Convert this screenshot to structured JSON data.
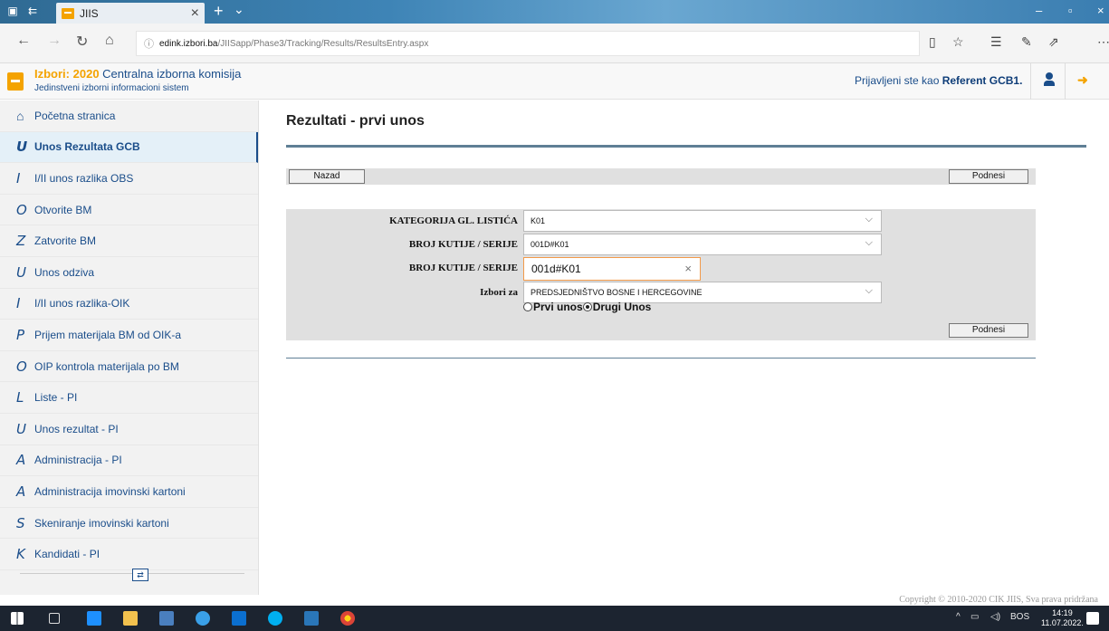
{
  "browser": {
    "tab_title": "JIIS",
    "url_host": "edink.izbori.ba",
    "url_path": "/JIISapp/Phase3/Tracking/Results/ResultsEntry.aspx"
  },
  "header": {
    "title_prefix": "Izbori:",
    "year": "2020",
    "title_rest": "Centralna izborna komisija",
    "subtitle": "Jedinstveni izborni informacioni sistem",
    "user_prefix": "Prijavljeni ste kao",
    "user_name": "Referent GCB1."
  },
  "sidebar": {
    "items": [
      {
        "letter": "",
        "label": "Početna stranica"
      },
      {
        "letter": "U",
        "label": "Unos Rezultata GCB"
      },
      {
        "letter": "I",
        "label": "I/II unos razlika OBS"
      },
      {
        "letter": "O",
        "label": "Otvorite BM"
      },
      {
        "letter": "Z",
        "label": "Zatvorite BM"
      },
      {
        "letter": "U",
        "label": "Unos odziva"
      },
      {
        "letter": "I",
        "label": "I/II unos razlika-OIK"
      },
      {
        "letter": "P",
        "label": "Prijem materijala BM od OIK-a"
      },
      {
        "letter": "O",
        "label": "OIP kontrola materijala po BM"
      },
      {
        "letter": "L",
        "label": "Liste - PI"
      },
      {
        "letter": "U",
        "label": "Unos rezultat - PI"
      },
      {
        "letter": "A",
        "label": "Administracija - PI"
      },
      {
        "letter": "A",
        "label": "Administracija imovinski kartoni"
      },
      {
        "letter": "S",
        "label": "Skeniranje imovinski kartoni"
      },
      {
        "letter": "K",
        "label": "Kandidati - PI"
      }
    ]
  },
  "main": {
    "page_title": "Rezultati - prvi unos",
    "back_label": "Nazad",
    "submit_label": "Podnesi",
    "form": {
      "category_label": "KATEGORIJA GL. LISTIĆA",
      "category_value": "K01",
      "box_label": "BROJ KUTIJE / SERIJE",
      "box_value": "001D#K01",
      "box_input_label": "BROJ KUTIJE / SERIJE",
      "box_input_value": "001d#K01",
      "elections_label": "Izbori za",
      "elections_value": "PREDSJEDNIŠTVO BOSNE I HERCEGOVINE",
      "radio_first": "Prvi unos",
      "radio_second": "Drugi Unos"
    }
  },
  "footer": {
    "copyright": "Copyright © 2010-2020 CIK JIIS, Sva prava pridržana"
  },
  "taskbar": {
    "language": "BOS",
    "time": "14:19",
    "date": "11.07.2022."
  },
  "colors": {
    "brand_blue": "#1a4d8a",
    "accent_orange": "#f4a300"
  }
}
